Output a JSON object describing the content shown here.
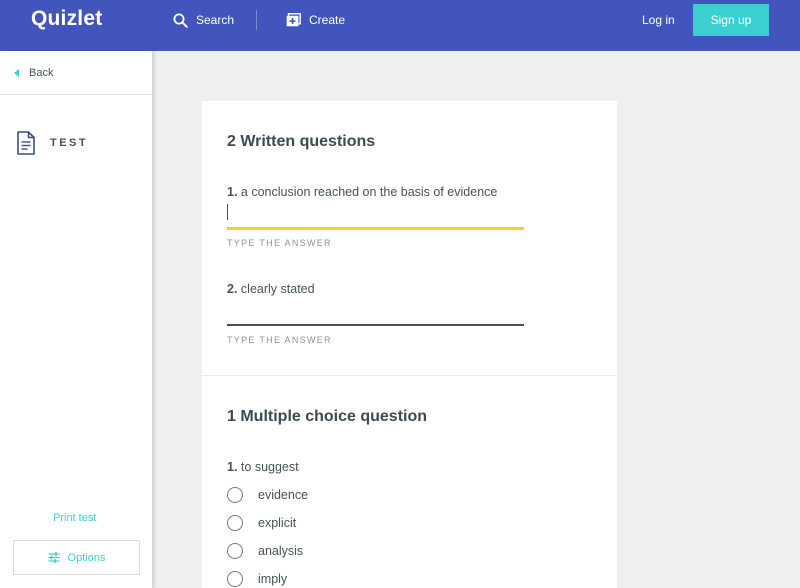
{
  "header": {
    "logo": "Quizlet",
    "search_label": "Search",
    "create_label": "Create",
    "login_label": "Log in",
    "signup_label": "Sign up"
  },
  "sidebar": {
    "back_label": "Back",
    "test_label": "TEST",
    "print_test_label": "Print test",
    "options_label": "Options"
  },
  "written": {
    "title": "2 Written questions",
    "questions": [
      {
        "number": "1.",
        "text": "a conclusion reached on the basis of evidence",
        "hint": "TYPE THE ANSWER"
      },
      {
        "number": "2.",
        "text": "clearly stated",
        "hint": "TYPE THE ANSWER"
      }
    ]
  },
  "multiple_choice": {
    "title": "1 Multiple choice question",
    "question": {
      "number": "1.",
      "text": "to suggest"
    },
    "options": [
      "evidence",
      "explicit",
      "analysis",
      "imply"
    ]
  },
  "colors": {
    "header_bg": "#4255bd",
    "accent": "#3ccfcf",
    "active_underline": "#ffcd1f"
  }
}
